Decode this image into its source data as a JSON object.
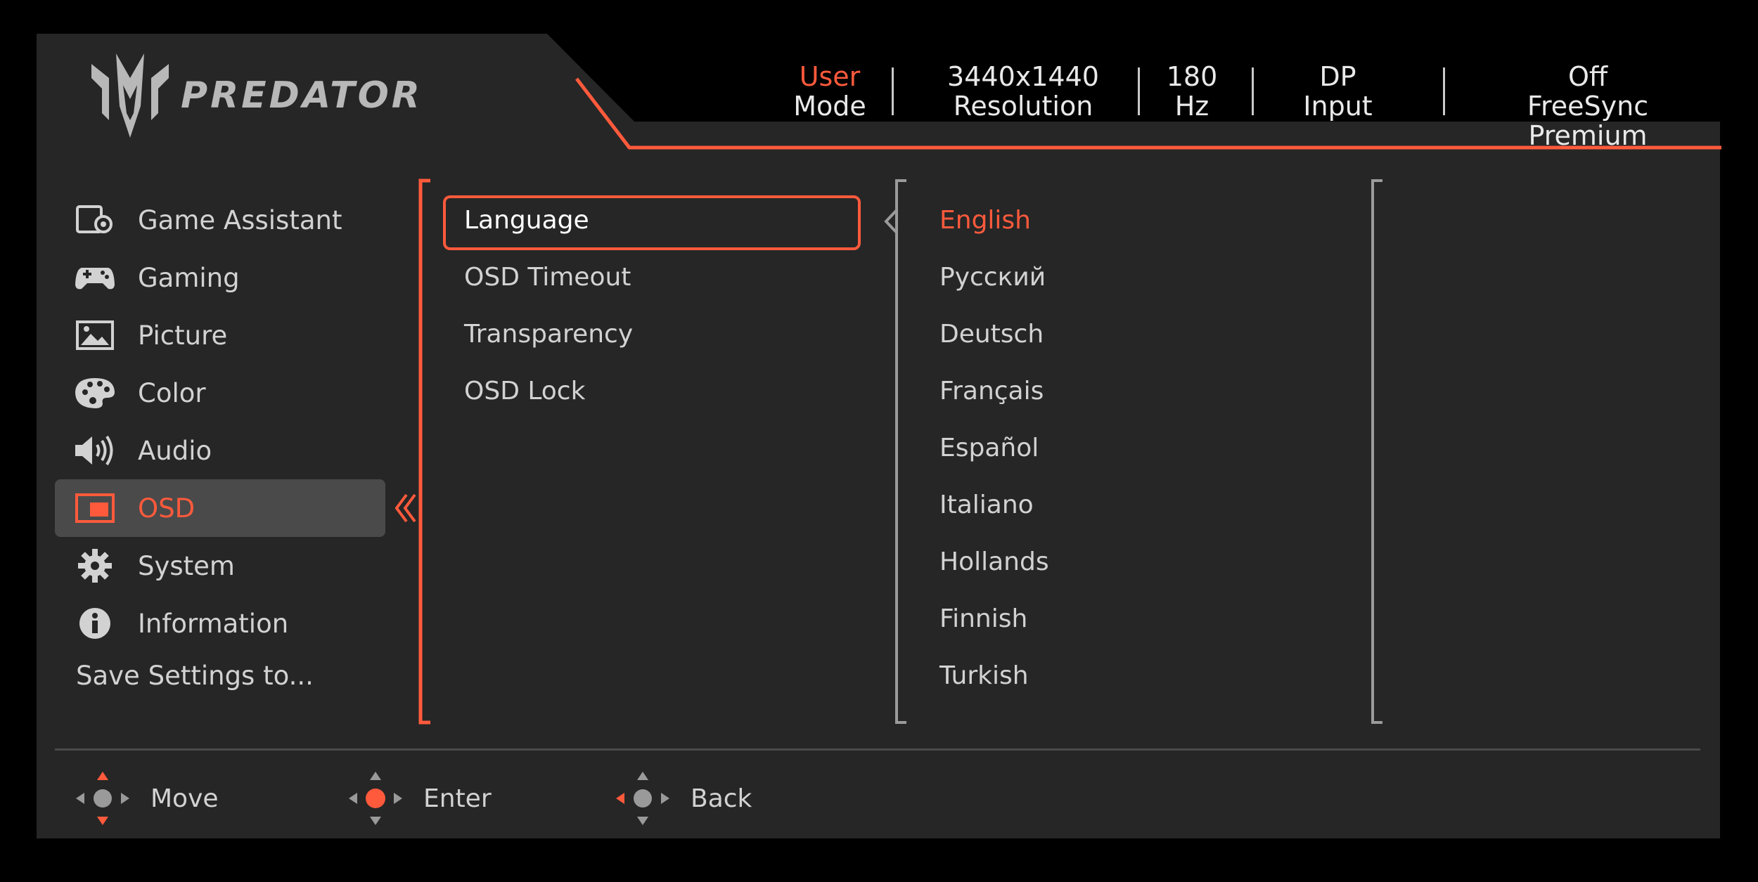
{
  "brand": {
    "logo_text": "PREDATOR",
    "icon": "predator-logo-icon"
  },
  "status_bar": {
    "mode": {
      "value": "User",
      "label": "Mode"
    },
    "resolution": {
      "value": "3440x1440",
      "label": "Resolution"
    },
    "refresh": {
      "value": "180",
      "label": "Hz"
    },
    "input": {
      "value": "DP",
      "label": "Input"
    },
    "freesync": {
      "value": "Off",
      "label": "FreeSync Premium"
    }
  },
  "main_menu": {
    "items": [
      {
        "label": "Game Assistant",
        "icon": "game-assistant-icon"
      },
      {
        "label": "Gaming",
        "icon": "gamepad-icon"
      },
      {
        "label": "Picture",
        "icon": "picture-icon"
      },
      {
        "label": "Color",
        "icon": "palette-icon"
      },
      {
        "label": "Audio",
        "icon": "speaker-icon"
      },
      {
        "label": "OSD",
        "icon": "osd-icon",
        "active": true
      },
      {
        "label": "System",
        "icon": "gear-icon"
      },
      {
        "label": "Information",
        "icon": "info-icon"
      }
    ],
    "save_label": "Save Settings to..."
  },
  "submenu": {
    "items": [
      "Language",
      "OSD Timeout",
      "Transparency",
      "OSD Lock"
    ],
    "selected": "Language"
  },
  "language_options": {
    "items": [
      "English",
      "Русский",
      "Deutsch",
      "Français",
      "Español",
      "Italiano",
      "Hollands",
      "Finnish",
      "Turkish"
    ],
    "selected": "English"
  },
  "footer": {
    "move": "Move",
    "enter": "Enter",
    "back": "Back"
  },
  "colors": {
    "accent": "#ff5a3c",
    "panel": "#262626",
    "text": "#d2d2d2"
  }
}
